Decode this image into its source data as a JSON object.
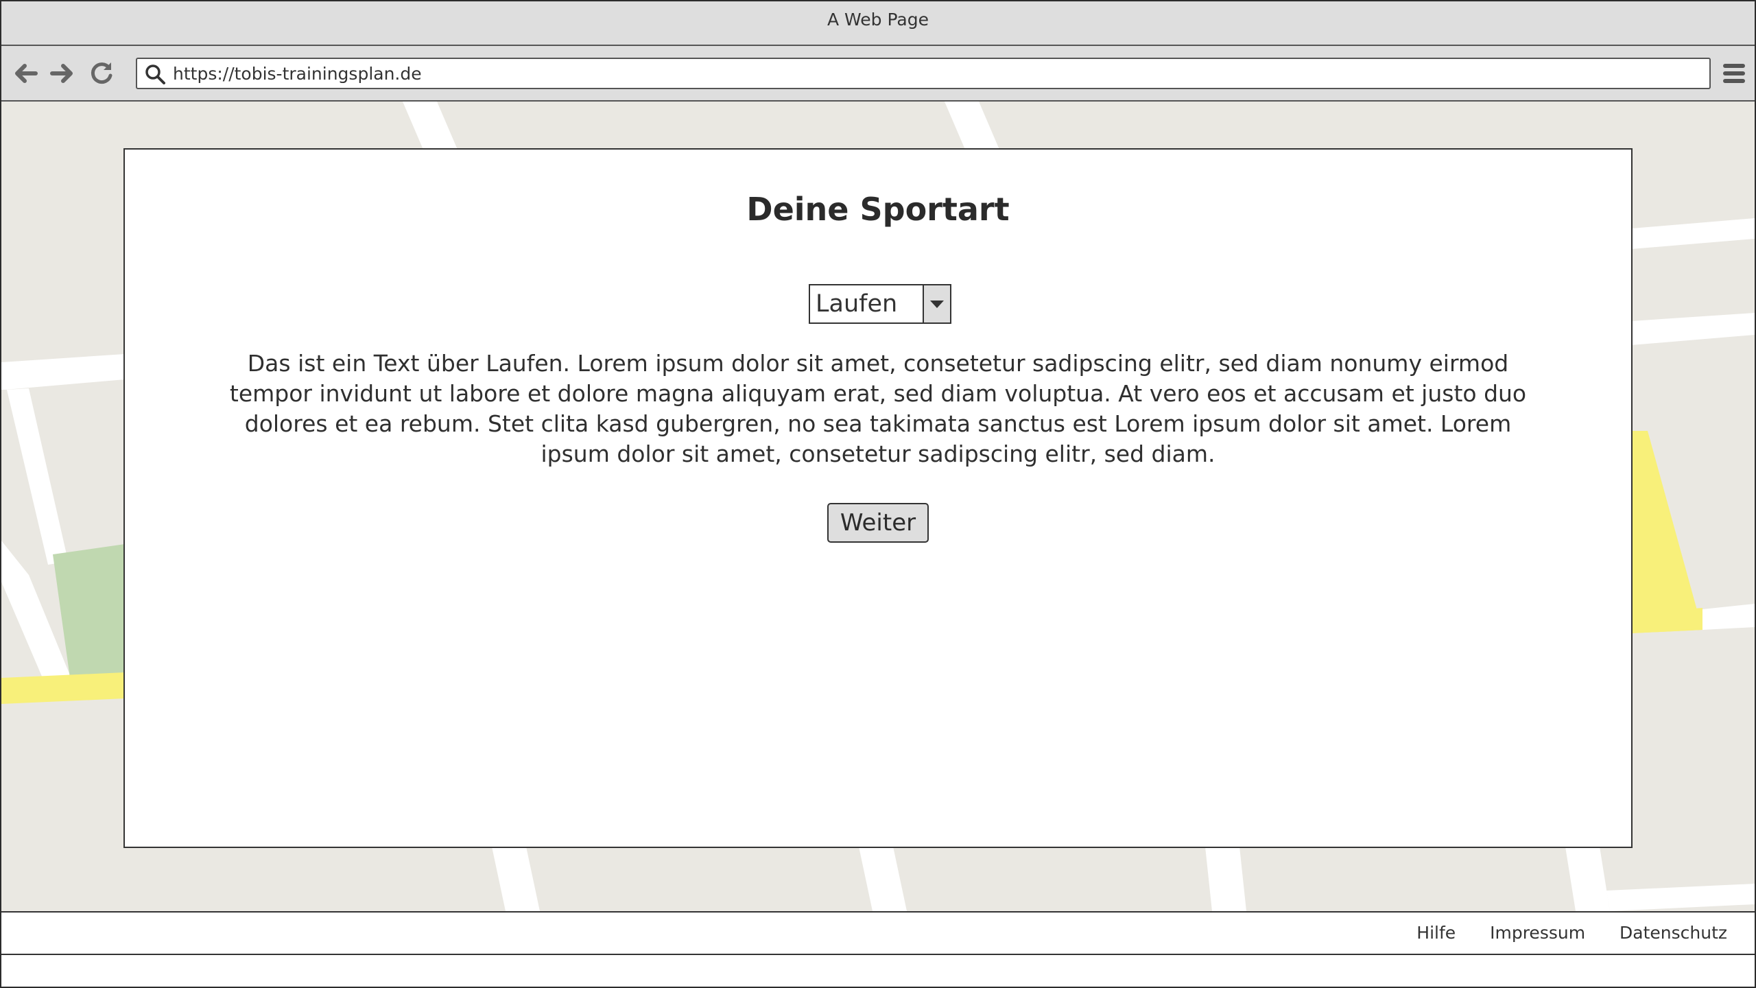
{
  "window": {
    "title": "A Web Page"
  },
  "toolbar": {
    "back_icon": "arrow-left-icon",
    "forward_icon": "arrow-right-icon",
    "reload_icon": "reload-icon",
    "search_icon": "search-icon",
    "menu_icon": "hamburger-menu-icon",
    "url": "https://tobis-trainingsplan.de"
  },
  "main": {
    "heading": "Deine Sportart",
    "sport_select": {
      "selected": "Laufen"
    },
    "description": "Das ist ein Text über Laufen. Lorem ipsum dolor sit amet, consetetur sadipscing elitr, sed diam nonumy eirmod tempor invidunt ut labore et dolore magna aliquyam erat, sed diam voluptua. At vero eos et accusam et justo duo dolores et ea rebum. Stet clita kasd gubergren, no sea takimata sanctus est Lorem ipsum dolor sit amet. Lorem ipsum dolor sit amet, consetetur sadipscing elitr, sed diam.",
    "continue_label": "Weiter"
  },
  "footer": {
    "links": [
      "Hilfe",
      "Impressum",
      "Datenschutz"
    ]
  },
  "colors": {
    "chrome": "#dedede",
    "map_base": "#eae8e2",
    "map_road": "#ffffff",
    "map_park": "#c0d8b0",
    "map_highway": "#f8f07a"
  }
}
